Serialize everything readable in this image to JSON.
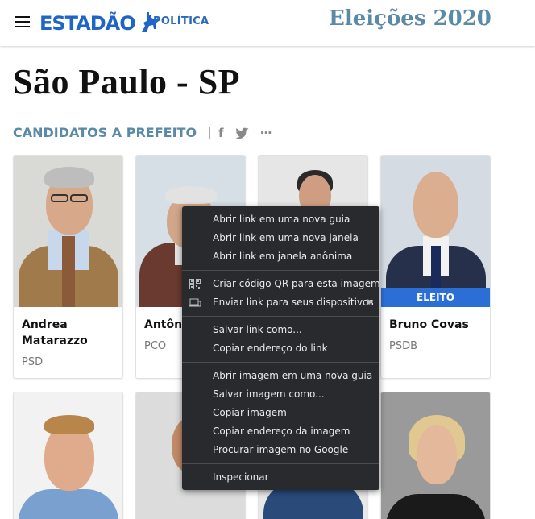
{
  "header": {
    "brand": "ESTADÃO",
    "section": "POLÍTICA",
    "elections": "Eleições 2020"
  },
  "page_title": "São Paulo - SP",
  "subhead": {
    "title": "CANDIDATOS A PREFEITO",
    "share_facebook": "f",
    "share_twitter": "🐦",
    "share_more": "···"
  },
  "candidates": [
    {
      "name": "Andrea Matarazzo",
      "party": "PSD",
      "badge": ""
    },
    {
      "name": "Antôni",
      "party": "PCO",
      "badge": ""
    },
    {
      "name": "",
      "party": "",
      "badge": ""
    },
    {
      "name": "Bruno Covas",
      "party": "PSDB",
      "badge": "ELEITO"
    }
  ],
  "context_menu": {
    "items": [
      {
        "label": "Abrir link em uma nova guia"
      },
      {
        "label": "Abrir link em uma nova janela"
      },
      {
        "label": "Abrir link em janela anônima"
      },
      {
        "label": "Criar código QR para esta imagem",
        "icon": "qr-code-icon"
      },
      {
        "label": "Enviar link para seus dispositivos",
        "icon": "device-icon"
      },
      {
        "label": "Salvar link como..."
      },
      {
        "label": "Copiar endereço do link"
      },
      {
        "label": "Abrir imagem em uma nova guia"
      },
      {
        "label": "Salvar imagem como..."
      },
      {
        "label": "Copiar imagem"
      },
      {
        "label": "Copiar endereço da imagem"
      },
      {
        "label": "Procurar imagem no Google"
      },
      {
        "label": "Inspecionar"
      }
    ]
  },
  "colors": {
    "brand_blue": "#1f65c7",
    "elections_teal": "#5a8aa6",
    "elected_badge": "#2b6fd6",
    "menu_bg": "#292a2d"
  }
}
